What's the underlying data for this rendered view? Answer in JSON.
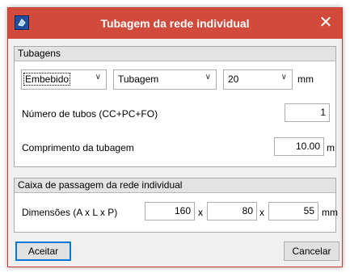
{
  "window": {
    "title": "Tubagem da rede individual",
    "close_glyph": "✕"
  },
  "tubagens": {
    "header": "Tubagens",
    "combo1": "Embebido",
    "combo2": "Tubagem",
    "combo3": "20",
    "combo3_unit": "mm",
    "num_tubos_label": "Número de tubos (CC+PC+FO)",
    "num_tubos_value": "1",
    "comprimento_label": "Comprimento da tubagem",
    "comprimento_value": "10.00",
    "comprimento_unit": "m"
  },
  "caixa": {
    "header": "Caixa de passagem da rede individual",
    "dim_label": "Dimensões (A x L x P)",
    "a_value": "160",
    "sep1": "x",
    "l_value": "80",
    "sep2": "x",
    "p_value": "55",
    "unit": "mm"
  },
  "buttons": {
    "accept": "Aceitar",
    "cancel": "Cancelar"
  },
  "dropdown_arrow": "∨",
  "colors": {
    "titlebar": "#d24a3b",
    "default_button_border": "#0078d7"
  },
  "icons": {
    "app": "app-icon",
    "close": "close-icon"
  }
}
